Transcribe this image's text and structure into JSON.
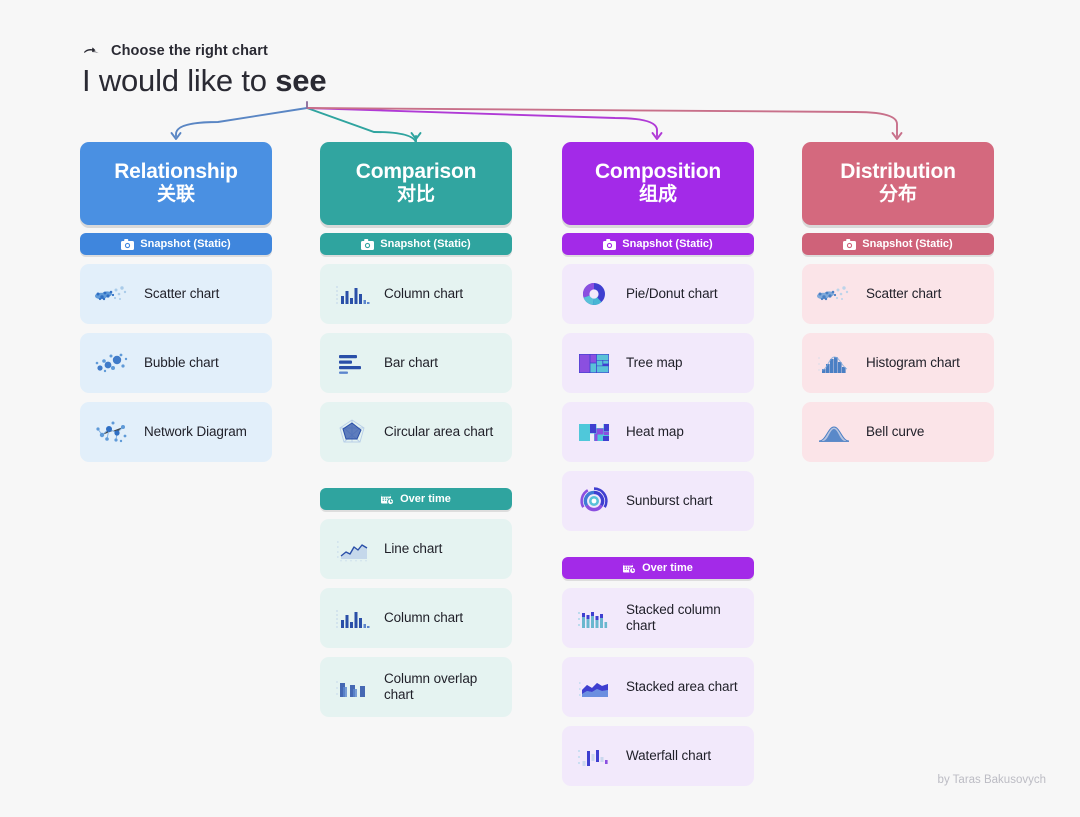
{
  "header": {
    "kicker_icon": "pointing-hand-icon",
    "kicker": "Choose the right chart",
    "headline_prefix": "I would like to ",
    "headline_emphasis": "see"
  },
  "credit": "by Taras Bakusovych",
  "badges": {
    "snapshot": "Snapshot (Static)",
    "snapshot_icon": "camera-icon",
    "over_time": "Over time",
    "over_time_icon": "calendar-clock-icon"
  },
  "columns": [
    {
      "key": "relationship",
      "title": "Relationship",
      "subtitle": "关联",
      "header_color": "#4a90e2",
      "badge_color": "#3f86dd",
      "card_color": "#e2effa",
      "arrow_color": "#5a86c4",
      "groups": [
        {
          "badge": "snapshot",
          "items": [
            {
              "label": "Scatter chart",
              "icon": "scatter-chart-icon"
            },
            {
              "label": "Bubble chart",
              "icon": "bubble-chart-icon"
            },
            {
              "label": "Network Diagram",
              "icon": "network-diagram-icon"
            }
          ]
        }
      ]
    },
    {
      "key": "comparison",
      "title": "Comparison",
      "subtitle": "对比",
      "header_color": "#31a5a0",
      "badge_color": "#2fa49f",
      "card_color": "#e5f3f1",
      "arrow_color": "#2fa49f",
      "groups": [
        {
          "badge": "snapshot",
          "items": [
            {
              "label": "Column chart",
              "icon": "column-chart-icon"
            },
            {
              "label": "Bar chart",
              "icon": "bar-chart-icon"
            },
            {
              "label": "Circular area chart",
              "icon": "circular-area-chart-icon"
            }
          ]
        },
        {
          "badge": "over_time",
          "items": [
            {
              "label": "Line chart",
              "icon": "line-chart-icon"
            },
            {
              "label": "Column chart",
              "icon": "column-chart-icon"
            },
            {
              "label": "Column overlap chart",
              "icon": "column-overlap-chart-icon"
            }
          ]
        }
      ]
    },
    {
      "key": "composition",
      "title": "Composition",
      "subtitle": "组成",
      "header_color": "#a32ae8",
      "badge_color": "#a32ae8",
      "card_color": "#f2e9fb",
      "arrow_color": "#b03ad6",
      "groups": [
        {
          "badge": "snapshot",
          "items": [
            {
              "label": "Pie/Donut chart",
              "icon": "pie-donut-chart-icon"
            },
            {
              "label": "Tree map",
              "icon": "tree-map-icon"
            },
            {
              "label": "Heat map",
              "icon": "heat-map-icon"
            },
            {
              "label": "Sunburst chart",
              "icon": "sunburst-chart-icon"
            }
          ]
        },
        {
          "badge": "over_time",
          "items": [
            {
              "label": "Stacked column chart",
              "icon": "stacked-column-chart-icon"
            },
            {
              "label": "Stacked area chart",
              "icon": "stacked-area-chart-icon"
            },
            {
              "label": "Waterfall chart",
              "icon": "waterfall-chart-icon"
            }
          ]
        }
      ]
    },
    {
      "key": "distribution",
      "title": "Distribution",
      "subtitle": "分布",
      "header_color": "#d4697e",
      "badge_color": "#cf6279",
      "card_color": "#fbe4e8",
      "arrow_color": "#c8708a",
      "groups": [
        {
          "badge": "snapshot",
          "items": [
            {
              "label": "Scatter chart",
              "icon": "scatter-chart-icon"
            },
            {
              "label": "Histogram chart",
              "icon": "histogram-chart-icon"
            },
            {
              "label": "Bell curve",
              "icon": "bell-curve-icon"
            }
          ]
        }
      ]
    }
  ]
}
